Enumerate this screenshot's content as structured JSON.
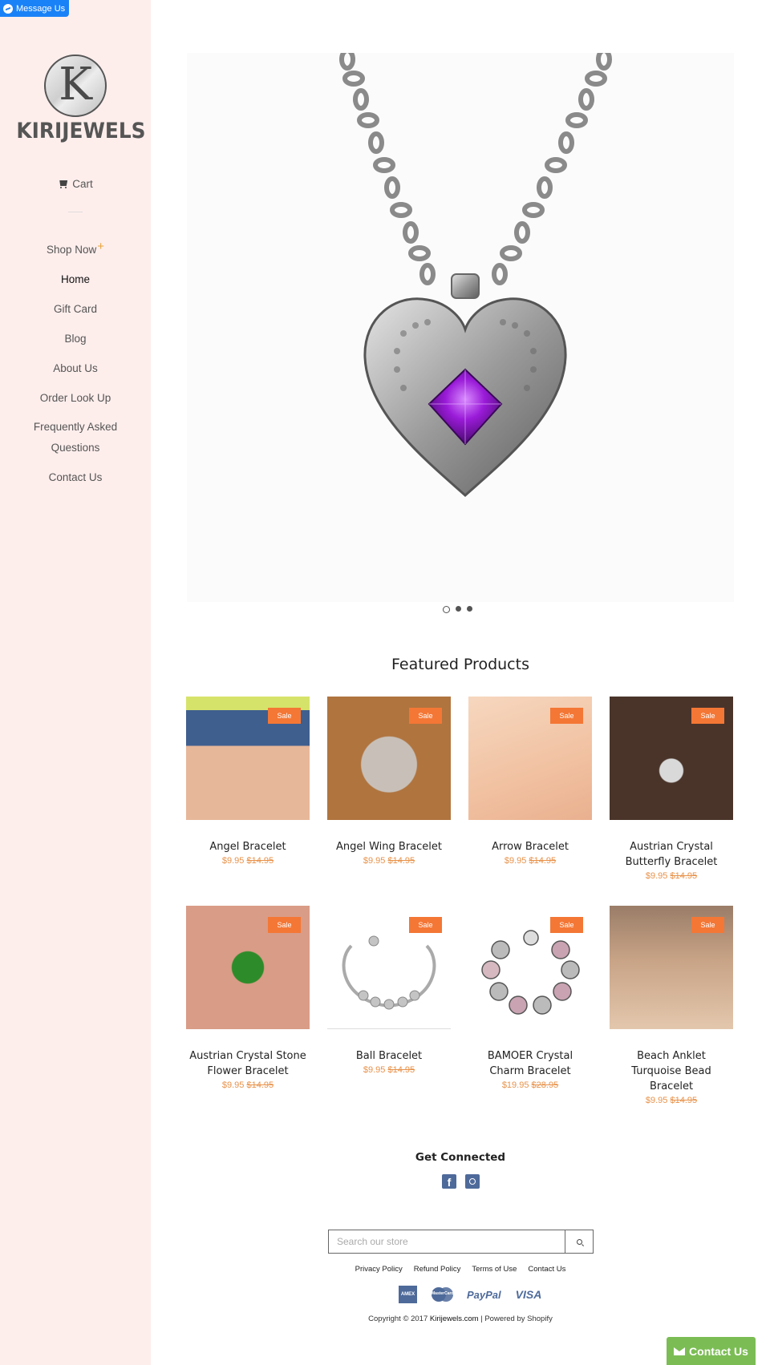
{
  "messenger": {
    "label": "Message Us"
  },
  "brand": {
    "logo_letter": "K",
    "name": "KIRIJEWELS"
  },
  "nav": {
    "cart_label": "Cart",
    "items": [
      {
        "label": "Shop Now",
        "has_submenu": true
      },
      {
        "label": "Home",
        "active": true
      },
      {
        "label": "Gift Card"
      },
      {
        "label": "Blog"
      },
      {
        "label": "About Us"
      },
      {
        "label": "Order Look Up"
      },
      {
        "label": "Frequently Asked Questions"
      },
      {
        "label": "Contact Us"
      }
    ],
    "submenu_indicator": "+"
  },
  "slideshow": {
    "slides": 3,
    "active_slide": 1,
    "image": "heart-pendant-necklace-purple-gem"
  },
  "featured": {
    "title": "Featured Products",
    "sale_badge": "Sale",
    "products": [
      {
        "name": "Angel Bracelet",
        "price": "$9.95",
        "compare_price": "$14.95",
        "on_sale": true
      },
      {
        "name": "Angel Wing Bracelet",
        "price": "$9.95",
        "compare_price": "$14.95",
        "on_sale": true
      },
      {
        "name": "Arrow Bracelet",
        "price": "$9.95",
        "compare_price": "$14.95",
        "on_sale": true
      },
      {
        "name": "Austrian Crystal Butterfly Bracelet",
        "price": "$9.95",
        "compare_price": "$14.95",
        "on_sale": true
      },
      {
        "name": "Austrian Crystal Stone Flower Bracelet",
        "price": "$9.95",
        "compare_price": "$14.95",
        "on_sale": true
      },
      {
        "name": "Ball Bracelet",
        "price": "$9.95",
        "compare_price": "$14.95",
        "on_sale": true
      },
      {
        "name": "BAMOER Crystal Charm Bracelet",
        "price": "$19.95",
        "compare_price": "$28.95",
        "on_sale": true
      },
      {
        "name": "Beach Anklet Turquoise Bead Bracelet",
        "price": "$9.95",
        "compare_price": "$14.95",
        "on_sale": true
      }
    ]
  },
  "footer": {
    "connected_title": "Get Connected",
    "social": [
      {
        "name": "facebook-icon",
        "glyph": "f"
      },
      {
        "name": "instagram-icon",
        "glyph": ""
      }
    ],
    "search_placeholder": "Search our store",
    "policies": [
      "Privacy Policy",
      "Refund Policy",
      "Terms of Use",
      "Contact Us"
    ],
    "payments": {
      "amex": "AMERICAN EXPRESS",
      "mastercard": "MasterCard",
      "paypal": "PayPal",
      "visa": "VISA"
    },
    "copyright_prefix": "Copyright © 2017",
    "site_link": "Kirijewels.com",
    "separator": "|",
    "powered": "Powered by Shopify"
  },
  "contact_widget": {
    "label": "Contact Us"
  },
  "colors": {
    "sidebar_bg": "#fdeeec",
    "sale": "#f47735",
    "price": "#e8924a",
    "contact": "#7bbd54",
    "messenger": "#1a82f7",
    "social": "#4e6a9a"
  }
}
